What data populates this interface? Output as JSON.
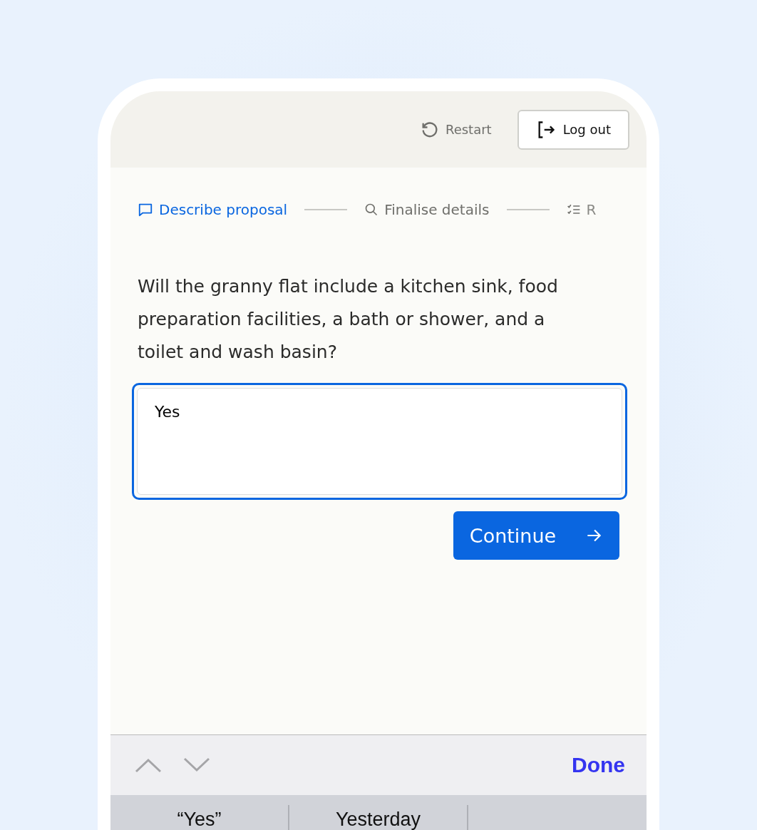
{
  "header": {
    "restart": "Restart",
    "logout": "Log out"
  },
  "steps": [
    {
      "label": "Describe proposal",
      "kind": "chat",
      "selected": true
    },
    {
      "label": "Finalise details",
      "kind": "search",
      "selected": false
    },
    {
      "label": "R",
      "kind": "checklist",
      "selected": false
    }
  ],
  "question": "Will the granny flat include a kitchen sink, food preparation facilities, a bath or shower, and a toilet and wash basin?",
  "answer": {
    "value": "Yes"
  },
  "continue": "Continue",
  "keyboard_toolbar": {
    "done": "Done"
  },
  "suggestions": [
    "“Yes”",
    "Yesterday"
  ]
}
